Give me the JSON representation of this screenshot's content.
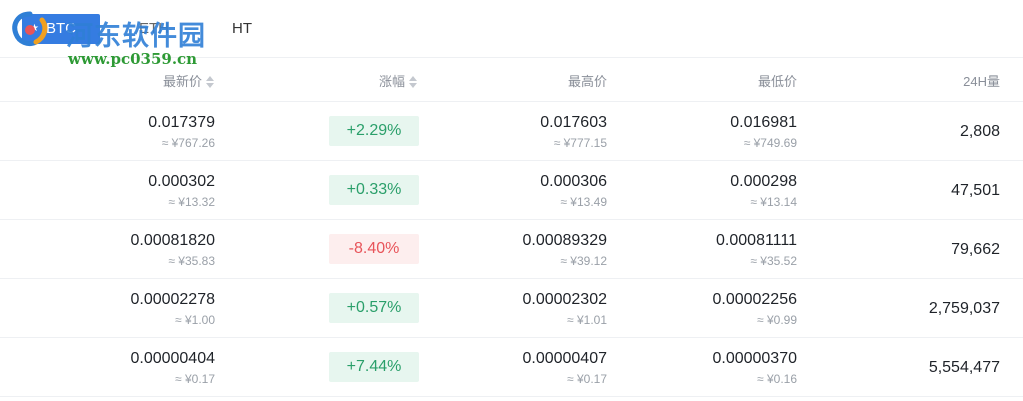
{
  "tabs": [
    {
      "label": "BTC",
      "active": true
    },
    {
      "label": "ETH",
      "active": false
    },
    {
      "label": "HT",
      "active": false
    }
  ],
  "watermark": {
    "title": "河东软件园",
    "url": "www.pc0359.cn"
  },
  "header": {
    "price": "最新价",
    "change": "涨幅",
    "high": "最高价",
    "low": "最低价",
    "volume": "24H量"
  },
  "colors": {
    "accent": "#357ce1",
    "up": "#2a9f6a",
    "down": "#e8545a"
  },
  "rows": [
    {
      "price": "0.017379",
      "price_cny": "≈ ¥767.26",
      "change": "+2.29%",
      "direction": "up",
      "high": "0.017603",
      "high_cny": "≈ ¥777.15",
      "low": "0.016981",
      "low_cny": "≈ ¥749.69",
      "volume": "2,808"
    },
    {
      "price": "0.000302",
      "price_cny": "≈ ¥13.32",
      "change": "+0.33%",
      "direction": "up",
      "high": "0.000306",
      "high_cny": "≈ ¥13.49",
      "low": "0.000298",
      "low_cny": "≈ ¥13.14",
      "volume": "47,501"
    },
    {
      "price": "0.00081820",
      "price_cny": "≈ ¥35.83",
      "change": "-8.40%",
      "direction": "down",
      "high": "0.00089329",
      "high_cny": "≈ ¥39.12",
      "low": "0.00081111",
      "low_cny": "≈ ¥35.52",
      "volume": "79,662"
    },
    {
      "price": "0.00002278",
      "price_cny": "≈ ¥1.00",
      "change": "+0.57%",
      "direction": "up",
      "high": "0.00002302",
      "high_cny": "≈ ¥1.01",
      "low": "0.00002256",
      "low_cny": "≈ ¥0.99",
      "volume": "2,759,037"
    },
    {
      "price": "0.00000404",
      "price_cny": "≈ ¥0.17",
      "change": "+7.44%",
      "direction": "up",
      "high": "0.00000407",
      "high_cny": "≈ ¥0.17",
      "low": "0.00000370",
      "low_cny": "≈ ¥0.16",
      "volume": "5,554,477"
    }
  ]
}
